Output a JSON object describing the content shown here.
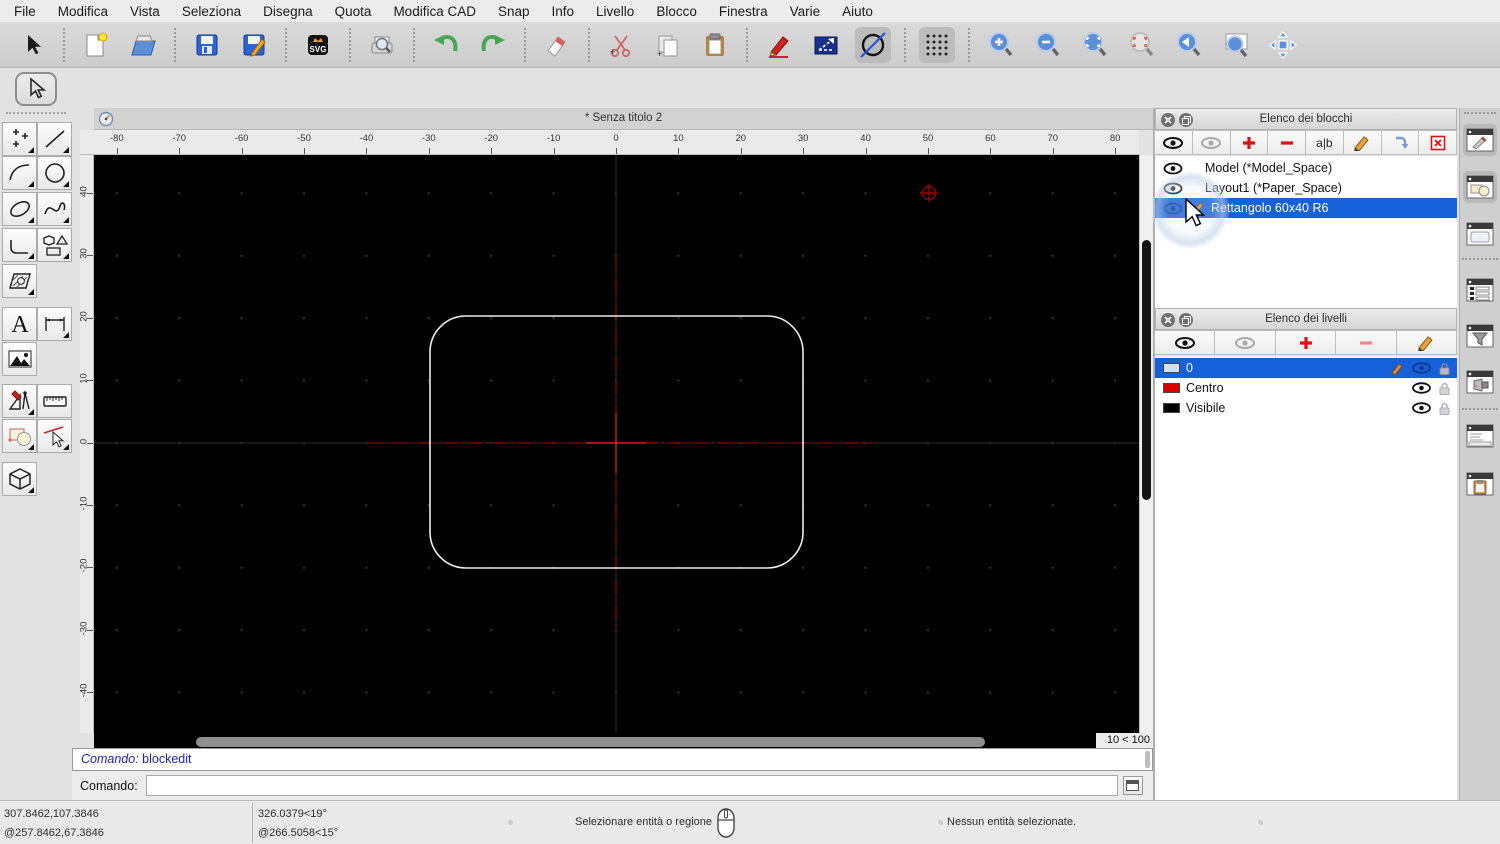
{
  "menu": {
    "items": [
      "File",
      "Modifica",
      "Vista",
      "Seleziona",
      "Disegna",
      "Quota",
      "Modifica CAD",
      "Snap",
      "Info",
      "Livello",
      "Blocco",
      "Finestra",
      "Varie",
      "Aiuto"
    ]
  },
  "toolbar": {
    "buttons": [
      "pointer",
      "new-document",
      "open-folder",
      "save",
      "save-as",
      "svg-export",
      "print-preview",
      "undo",
      "redo",
      "eraser",
      "cut",
      "copy",
      "paste",
      "pen",
      "selection-rectangle",
      "draft-circle-slash",
      "grid-toggle",
      "zoom-in",
      "zoom-out",
      "zoom-auto",
      "zoom-selection",
      "zoom-previous",
      "zoom-window",
      "pan"
    ]
  },
  "sidebar": {
    "tools": [
      "select-arrow",
      "points",
      "line",
      "arc",
      "circle",
      "ellipse",
      "spline",
      "polyline",
      "shapes",
      "hatch",
      "text",
      "dimension",
      "image",
      "draw-tools",
      "measure",
      "block",
      "modify",
      "solid-3d"
    ]
  },
  "canvas": {
    "title": "* Senza titolo 2",
    "zoom_indicator": "10 < 100",
    "h_ruler_labels": [
      "-80",
      "-70",
      "-60",
      "-50",
      "-40",
      "-30",
      "-20",
      "-10",
      "0",
      "10",
      "20",
      "30",
      "40",
      "50",
      "60",
      "70",
      "80"
    ],
    "v_ruler_labels": [
      "40",
      "30",
      "20",
      "10",
      "0",
      "-10",
      "-20",
      "-30",
      "-40"
    ],
    "entity": {
      "name": "Rettangolo 60x40 R6",
      "width_units": 60,
      "height_units": 40,
      "corner_radius_units": 6
    }
  },
  "panels": {
    "blocks": {
      "title": "Elenco dei blocchi",
      "rename_label": "a|b",
      "items": [
        {
          "label": "Model (*Model_Space)",
          "selected": false
        },
        {
          "label": "Layout1 (*Paper_Space)",
          "selected": false
        },
        {
          "label": "Rettangolo 60x40 R6",
          "selected": true
        }
      ]
    },
    "layers": {
      "title": "Elenco dei livelli",
      "items": [
        {
          "label": "0",
          "swatch": "#cfe0f4",
          "selected": true
        },
        {
          "label": "Centro",
          "swatch": "#dd0000",
          "selected": false
        },
        {
          "label": "Visibile",
          "swatch": "#000000",
          "selected": false
        }
      ]
    }
  },
  "command": {
    "history_prompt": "Comando:",
    "history_command": "blockedit",
    "prompt": "Comando:",
    "input_value": ""
  },
  "status": {
    "abs_cartesian": "307.8462,107.3846",
    "rel_cartesian": "@257.8462,67.3846",
    "abs_polar": "326.0379<19°",
    "rel_polar": "@266.5058<15°",
    "left_button_hint": "Selezionare entità o regione",
    "selection_status": "Nessun entità selezionate."
  },
  "colors": {
    "selection_blue": "#1660d9",
    "canvas_bg": "#000000",
    "centerline_red": "#b80000",
    "crosshair_red": "#ff2222",
    "entity_stroke": "#ededed"
  }
}
